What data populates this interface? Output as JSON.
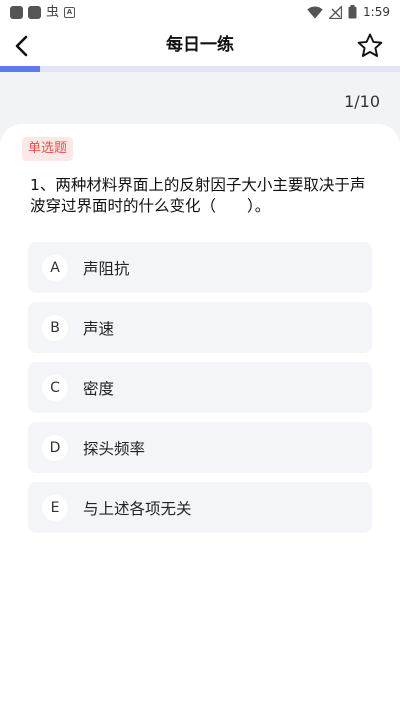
{
  "status_bar": {
    "time": "1:59",
    "app_glyph": "虫",
    "a_glyph": "A"
  },
  "header": {
    "title": "每日一练"
  },
  "progress": {
    "current": 1,
    "total": 10,
    "counter_text": "1/10",
    "accent_color": "#5b7be8"
  },
  "question": {
    "type_label": "单选题",
    "text": "1、两种材料界面上的反射因子大小主要取决于声波穿过界面时的什么变化（　　）。",
    "options": [
      {
        "letter": "A",
        "text": "声阻抗"
      },
      {
        "letter": "B",
        "text": "声速"
      },
      {
        "letter": "C",
        "text": "密度"
      },
      {
        "letter": "D",
        "text": "探头频率"
      },
      {
        "letter": "E",
        "text": "与上述各项无关"
      }
    ]
  }
}
